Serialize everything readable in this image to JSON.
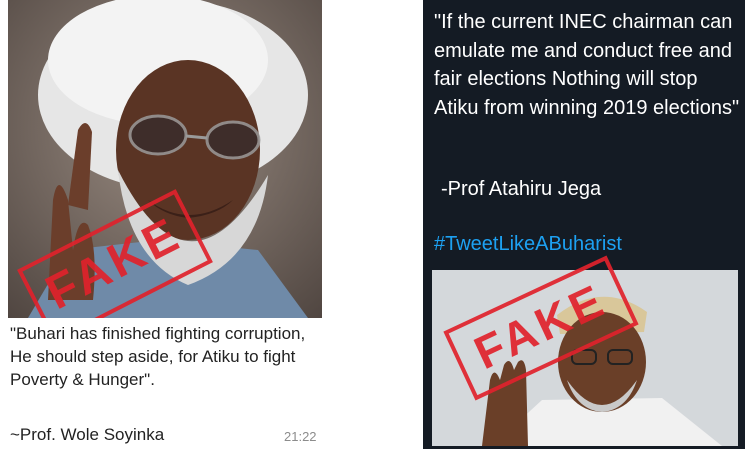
{
  "left": {
    "quote": "\"Buhari has finished fighting corruption, He should step aside, for Atiku to fight Poverty & Hunger\".",
    "author": "~Prof. Wole Soyinka",
    "time": "21:22",
    "stamp": "FAKE"
  },
  "right": {
    "quote": "\"If the current INEC chairman can emulate me and conduct free and fair elections Nothing will stop Atiku from winning 2019 elections\"",
    "author": "-Prof Atahiru Jega",
    "hashtag": "#TweetLikeABuharist",
    "stamp": "FAKE"
  },
  "colors": {
    "stamp": "#e0222c",
    "tweet_bg": "#141b24",
    "hashtag": "#1da1f2"
  }
}
